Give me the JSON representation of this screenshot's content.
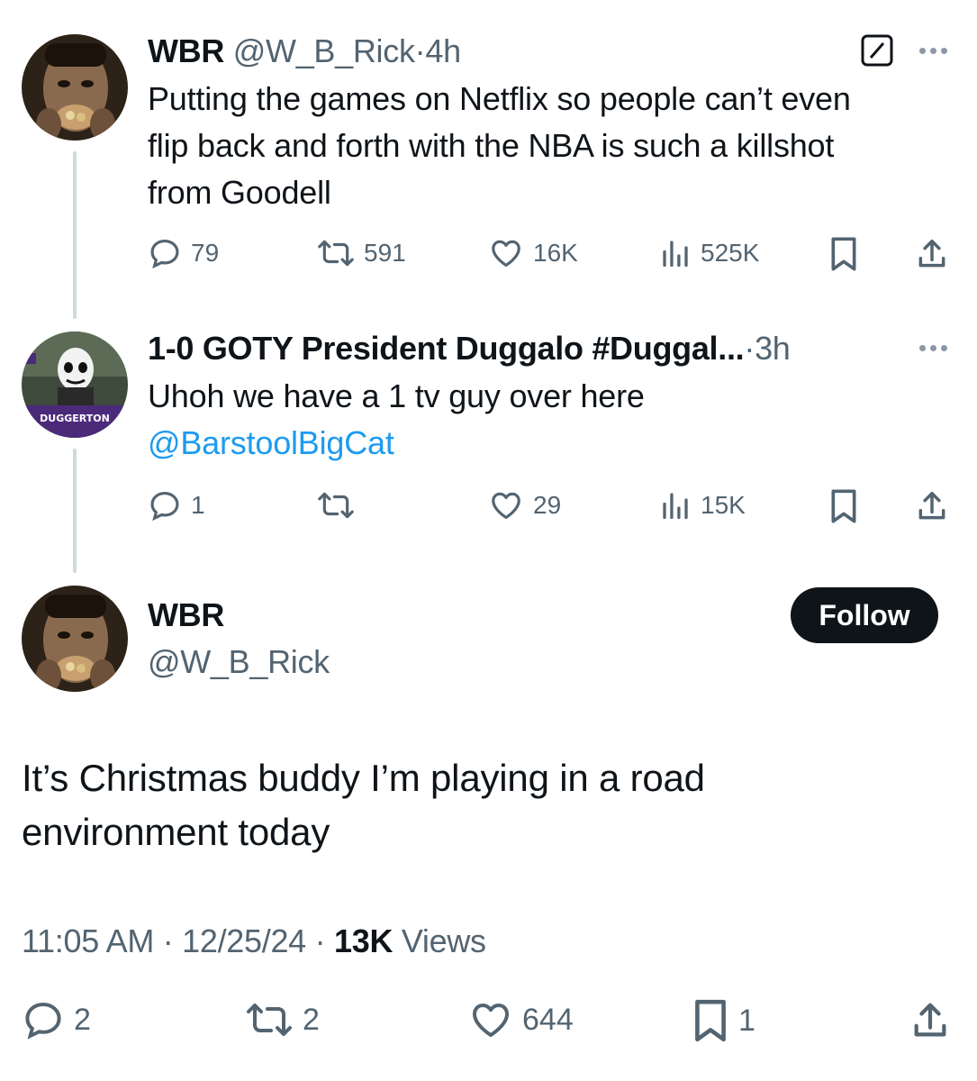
{
  "tweet1": {
    "name": "WBR",
    "handle": "@W_B_Rick",
    "sep": "·",
    "time": "4h",
    "text_lines": [
      "Putting the games on Netflix so people can’t even",
      "flip back and forth with the NBA is such a killshot",
      "from Goodell"
    ],
    "replies": "79",
    "retweets": "591",
    "likes": "16K",
    "views": "525K"
  },
  "tweet2": {
    "name": "1-0 GOTY President Duggalo #Duggal...",
    "sep": "·",
    "time": "3h",
    "text_line": "Uhoh we have a 1 tv guy over here",
    "mention": "@BarstoolBigCat",
    "avatar_banner": "DUGGERTON",
    "replies": "1",
    "likes": "29",
    "views": "15K"
  },
  "main": {
    "name": "WBR",
    "handle": "@W_B_Rick",
    "follow_label": "Follow",
    "text_lines": [
      "It’s Christmas buddy I’m playing in a road",
      "environment today"
    ],
    "time": "11:05 AM",
    "sep": "·",
    "date": "12/25/24",
    "views_count": "13K",
    "views_label": "Views",
    "replies": "2",
    "retweets": "2",
    "likes": "644",
    "bookmarks": "1"
  },
  "colors": {
    "text": "#0f1419",
    "muted": "#536471",
    "link": "#1d9bf0",
    "thread_line": "#cfd9de"
  }
}
